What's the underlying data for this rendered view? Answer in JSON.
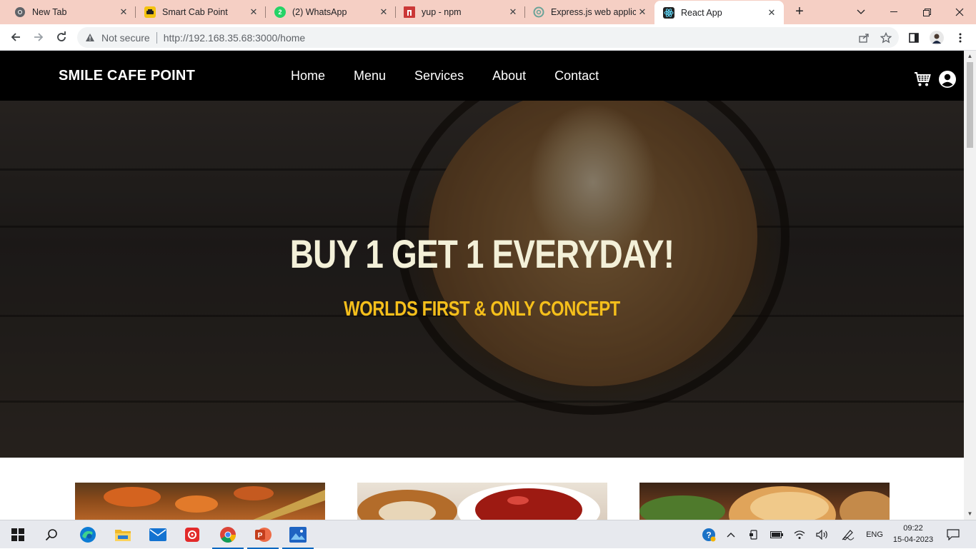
{
  "browser": {
    "tabs": [
      {
        "title": "New Tab",
        "favicon": "chrome-icon",
        "color": "#5f6368"
      },
      {
        "title": "Smart Cab Point",
        "favicon": "taxi-icon",
        "color": "#f3c20f"
      },
      {
        "title": "(2) WhatsApp",
        "favicon": "whatsapp-icon",
        "color": "#25d366"
      },
      {
        "title": "yup - npm",
        "favicon": "npm-icon",
        "color": "#cb3837"
      },
      {
        "title": "Express.js web applica",
        "favicon": "chatgpt-icon",
        "color": "#6aa398"
      },
      {
        "title": "React App",
        "favicon": "react-icon",
        "color": "#222222"
      }
    ],
    "address": {
      "security_label": "Not secure",
      "url": "http://192.168.35.68:3000/home"
    }
  },
  "site": {
    "brand": "SMILE CAFE POINT",
    "nav": [
      "Home",
      "Menu",
      "Services",
      "About",
      "Contact"
    ],
    "hero": {
      "title": "BUY 1 GET 1 EVERYDAY!",
      "subtitle": "WORLDS FIRST & ONLY CONCEPT",
      "title_color": "#f3f0d8",
      "subtitle_color": "#f5bf1b"
    }
  },
  "taskbar": {
    "language": "ENG",
    "time": "09:22",
    "date": "15-04-2023"
  }
}
